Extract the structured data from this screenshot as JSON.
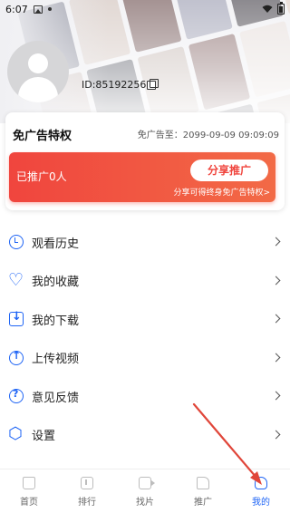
{
  "status_bar": {
    "time": "6:07"
  },
  "header": {
    "user_id": "ID:85192256",
    "poster_colors": [
      "#3b3f58",
      "#c9b8b0",
      "#5b3a3a",
      "#8d8fa6",
      "#2e2a33",
      "#d9c7bd",
      "#4a4e66",
      "#a88f86",
      "#2b2e3c",
      "#b7a7a0",
      "#6c4848",
      "#e0d6d2",
      "#3c3a4c",
      "#9a8b8a",
      "#d4c5bf",
      "#44405a",
      "#7c6b6e",
      "#282a38",
      "#c2b3ad",
      "#55516b",
      "#8f7c78"
    ]
  },
  "card": {
    "title": "免广告特权",
    "expire_text": "免广告至：2099-09-09 09:09:09",
    "promo": {
      "count_text": "已推广0人",
      "share_button": "分享推广",
      "tip": "分享可得终身免广告特权>"
    }
  },
  "menu": [
    {
      "label": "观看历史",
      "icon": "history-icon"
    },
    {
      "label": "我的收藏",
      "icon": "heart-icon"
    },
    {
      "label": "我的下载",
      "icon": "download-icon"
    },
    {
      "label": "上传视频",
      "icon": "upload-icon"
    },
    {
      "label": "意见反馈",
      "icon": "feedback-icon"
    },
    {
      "label": "设置",
      "icon": "settings-icon"
    }
  ],
  "bottom_nav": [
    {
      "label": "首页",
      "icon": "home-icon",
      "active": false
    },
    {
      "label": "排行",
      "icon": "rank-icon",
      "active": false
    },
    {
      "label": "找片",
      "icon": "film-icon",
      "active": false
    },
    {
      "label": "推广",
      "icon": "thumbs-up-icon",
      "active": false
    },
    {
      "label": "我的",
      "icon": "profile-icon",
      "active": true
    }
  ],
  "colors": {
    "accent": "#1e64f5",
    "promo_red": "#f0453e",
    "annotation_arrow": "#e0463a"
  }
}
